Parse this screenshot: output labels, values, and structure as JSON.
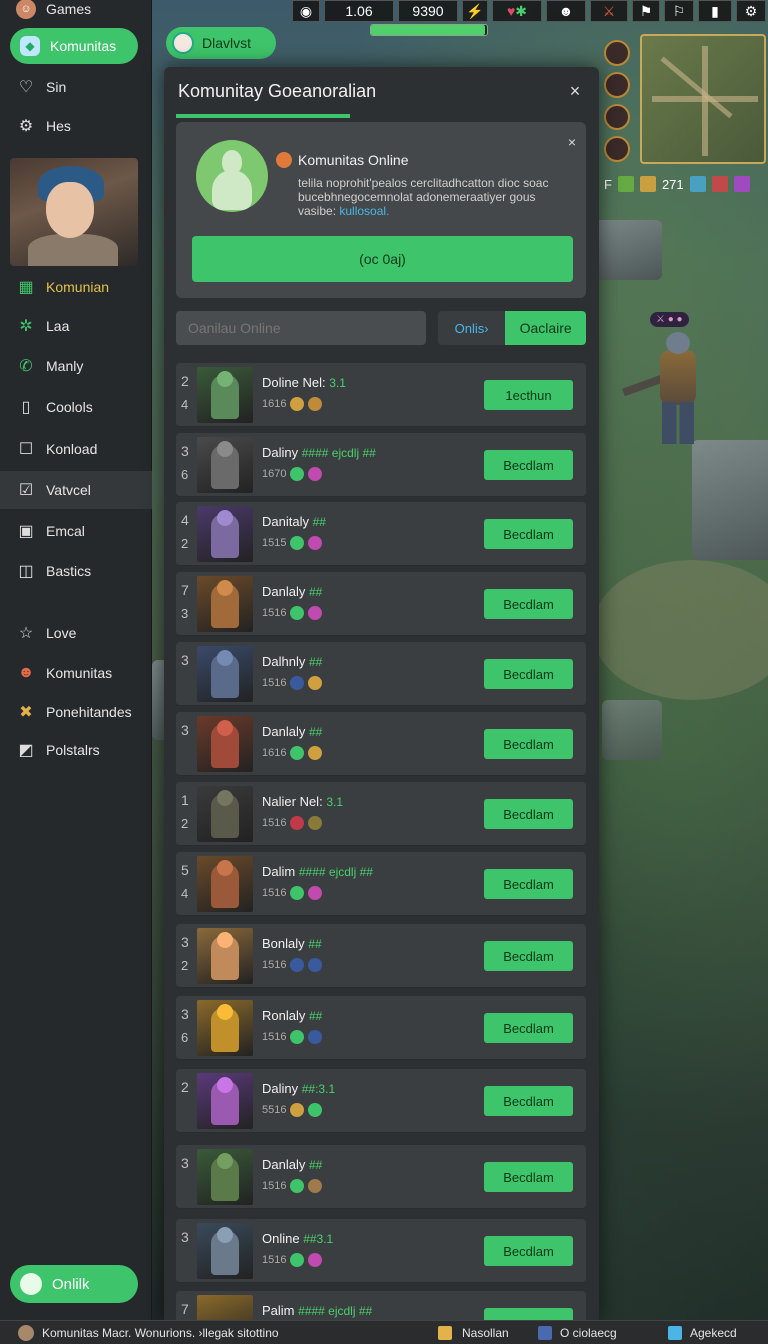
{
  "sidebar": {
    "items": [
      {
        "label": "Games",
        "icon": "game-avatar-icon"
      },
      {
        "label": "Komunitas",
        "icon": "community-icon"
      },
      {
        "label": "Sin",
        "icon": "heart-icon"
      },
      {
        "label": "Hes",
        "icon": "gear-icon"
      },
      {
        "label": "Komunian",
        "icon": "grid-icon"
      },
      {
        "label": "Laa",
        "icon": "puzzle-icon"
      },
      {
        "label": "Manly",
        "icon": "phone-icon"
      },
      {
        "label": "Coolols",
        "icon": "document-icon"
      },
      {
        "label": "Konload",
        "icon": "square-icon"
      },
      {
        "label": "Vatvcel",
        "icon": "checkbox-icon"
      },
      {
        "label": "Emcal",
        "icon": "image-icon"
      },
      {
        "label": "Bastics",
        "icon": "card-icon"
      },
      {
        "label": "Love",
        "icon": "star-icon"
      },
      {
        "label": "Komunitas",
        "icon": "avatar-icon"
      },
      {
        "label": "Ponehitandes",
        "icon": "puzzle-yellow-icon"
      },
      {
        "label": "Polstalrs",
        "icon": "picture-icon"
      }
    ],
    "bottom_pill": "Onlilk"
  },
  "hud": {
    "level": "1.06",
    "gold": "9390",
    "bar_fill": 0.98
  },
  "side_stats": {
    "prefix": "F",
    "value": "271"
  },
  "top_pill": {
    "label": "Dlavlvst"
  },
  "modal": {
    "title": "Komunitay Goeanoralian",
    "close_label": "×",
    "card": {
      "badge": "Komunitas Online",
      "description_main": "telila noprohit'pealos cerclitadhcatton dioc soac bucebhnegocemnolat adonemeraatiyer gous vasibe:",
      "description_link": "kullosoal.",
      "close_label": "×",
      "cta_label": "(oc 0aj)"
    },
    "search_placeholder": "Oanilau Online",
    "seg_left": "Onlis›",
    "seg_right": "Oaclaire"
  },
  "rows": [
    {
      "rank_a": "2",
      "rank_b": "4",
      "name": "Doline Nel:",
      "tag": "3.1",
      "sub": "1616",
      "thumb": "#3a5a3a",
      "fig": "#5a8a5a",
      "e1": "#d0a040",
      "e2": "#c08a3a"
    },
    {
      "rank_a": "3",
      "rank_b": "6",
      "name": "Daliny",
      "tag": "#### ejcdlj ##",
      "sub": "1670",
      "thumb": "#4a4a4a",
      "fig": "#6a6a6a",
      "e1": "#3ec46a",
      "e2": "#c04ab0"
    },
    {
      "rank_a": "4",
      "rank_b": "2",
      "name": "Danitaly",
      "tag": "##",
      "sub": "1515",
      "thumb": "#4a3a6a",
      "fig": "#7a6aa0",
      "e1": "#3ec46a",
      "e2": "#c04ab0"
    },
    {
      "rank_a": "7",
      "rank_b": "3",
      "name": "Danlaly",
      "tag": "##",
      "sub": "1516",
      "thumb": "#6a4a2a",
      "fig": "#a06a3a",
      "e1": "#3ec46a",
      "e2": "#c04ab0"
    },
    {
      "rank_a": "3",
      "rank_b": "",
      "name": "Dalhnly",
      "tag": "##",
      "sub": "1516",
      "thumb": "#3a4a6a",
      "fig": "#5a6a8a",
      "e1": "#3a5aa0",
      "e2": "#d0a040"
    },
    {
      "rank_a": "3",
      "rank_b": "",
      "name": "Danlaly",
      "tag": "##",
      "sub": "1616",
      "thumb": "#6a3a2a",
      "fig": "#a04a3a",
      "e1": "#3ec46a",
      "e2": "#d0a040"
    },
    {
      "rank_a": "1",
      "rank_b": "2",
      "name": "Nalier Nel:",
      "tag": "3.1",
      "sub": "1516",
      "thumb": "#3a3a3a",
      "fig": "#5a5a4a",
      "e1": "#c03a4a",
      "e2": "#8a7a3a"
    },
    {
      "rank_a": "5",
      "rank_b": "4",
      "name": "Dalim",
      "tag": "#### ejcdlj ##",
      "sub": "1516",
      "thumb": "#6a4a2a",
      "fig": "#9a5a3a",
      "e1": "#3ec46a",
      "e2": "#c04ab0"
    },
    {
      "rank_a": "3",
      "rank_b": "2",
      "name": "Bonlaly",
      "tag": "##",
      "sub": "1516",
      "thumb": "#8a6a3a",
      "fig": "#c08a5a",
      "e1": "#3a5aa0",
      "e2": "#3a5aa0"
    },
    {
      "rank_a": "3",
      "rank_b": "6",
      "name": "Ronlaly",
      "tag": "##",
      "sub": "1516",
      "thumb": "#8a6a2a",
      "fig": "#c0902a",
      "e1": "#3ec46a",
      "e2": "#3a5aa0"
    },
    {
      "rank_a": "2",
      "rank_b": "",
      "name": "Daliny",
      "tag": "##:3.1",
      "sub": "5516",
      "thumb": "#5a3a7a",
      "fig": "#9a5ab0",
      "e1": "#d0a040",
      "e2": "#3ec46a"
    },
    {
      "rank_a": "3",
      "rank_b": "",
      "name": "Danlaly",
      "tag": "##",
      "sub": "1516",
      "thumb": "#3a5a3a",
      "fig": "#5a7a4a",
      "e1": "#3ec46a",
      "e2": "#a07a4a"
    },
    {
      "rank_a": "3",
      "rank_b": "",
      "name": "Online",
      "tag": "##3.1",
      "sub": "1516",
      "thumb": "#3a4a5a",
      "fig": "#6a7a8a",
      "e1": "#3ec46a",
      "e2": "#c04ab0"
    }
  ],
  "row_action_first": "1ecthun",
  "row_action": "Becdlam",
  "last_row_partial": {
    "rank_a": "7",
    "name": "Palim",
    "tag": "#### ejcdlj ##"
  },
  "statusbar": {
    "left": "Komunitas Macr. Wonurions. ›llegak sitottino",
    "mid": "Nasollan",
    "seg2": "O ciolaecg",
    "seg3": "Agekecd"
  }
}
